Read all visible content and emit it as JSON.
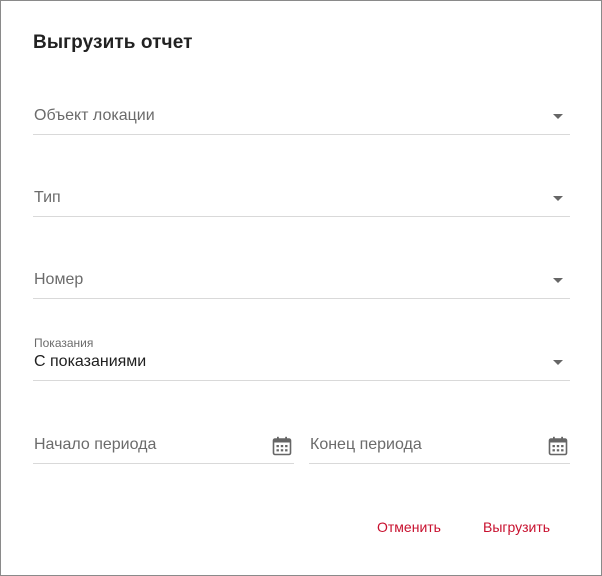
{
  "dialog": {
    "title": "Выгрузить отчет"
  },
  "fields": {
    "location_object": {
      "placeholder": "Объект локации"
    },
    "type": {
      "placeholder": "Тип"
    },
    "number": {
      "placeholder": "Номер"
    },
    "readings": {
      "label": "Показания",
      "value": "С показаниями"
    },
    "period_start": {
      "placeholder": "Начало периода"
    },
    "period_end": {
      "placeholder": "Конец периода"
    }
  },
  "actions": {
    "cancel_label": "Отменить",
    "export_label": "Выгрузить"
  },
  "icons": {
    "dropdown": "chevron-down-icon",
    "calendar": "calendar-icon"
  },
  "colors": {
    "accent": "#c8102e"
  }
}
